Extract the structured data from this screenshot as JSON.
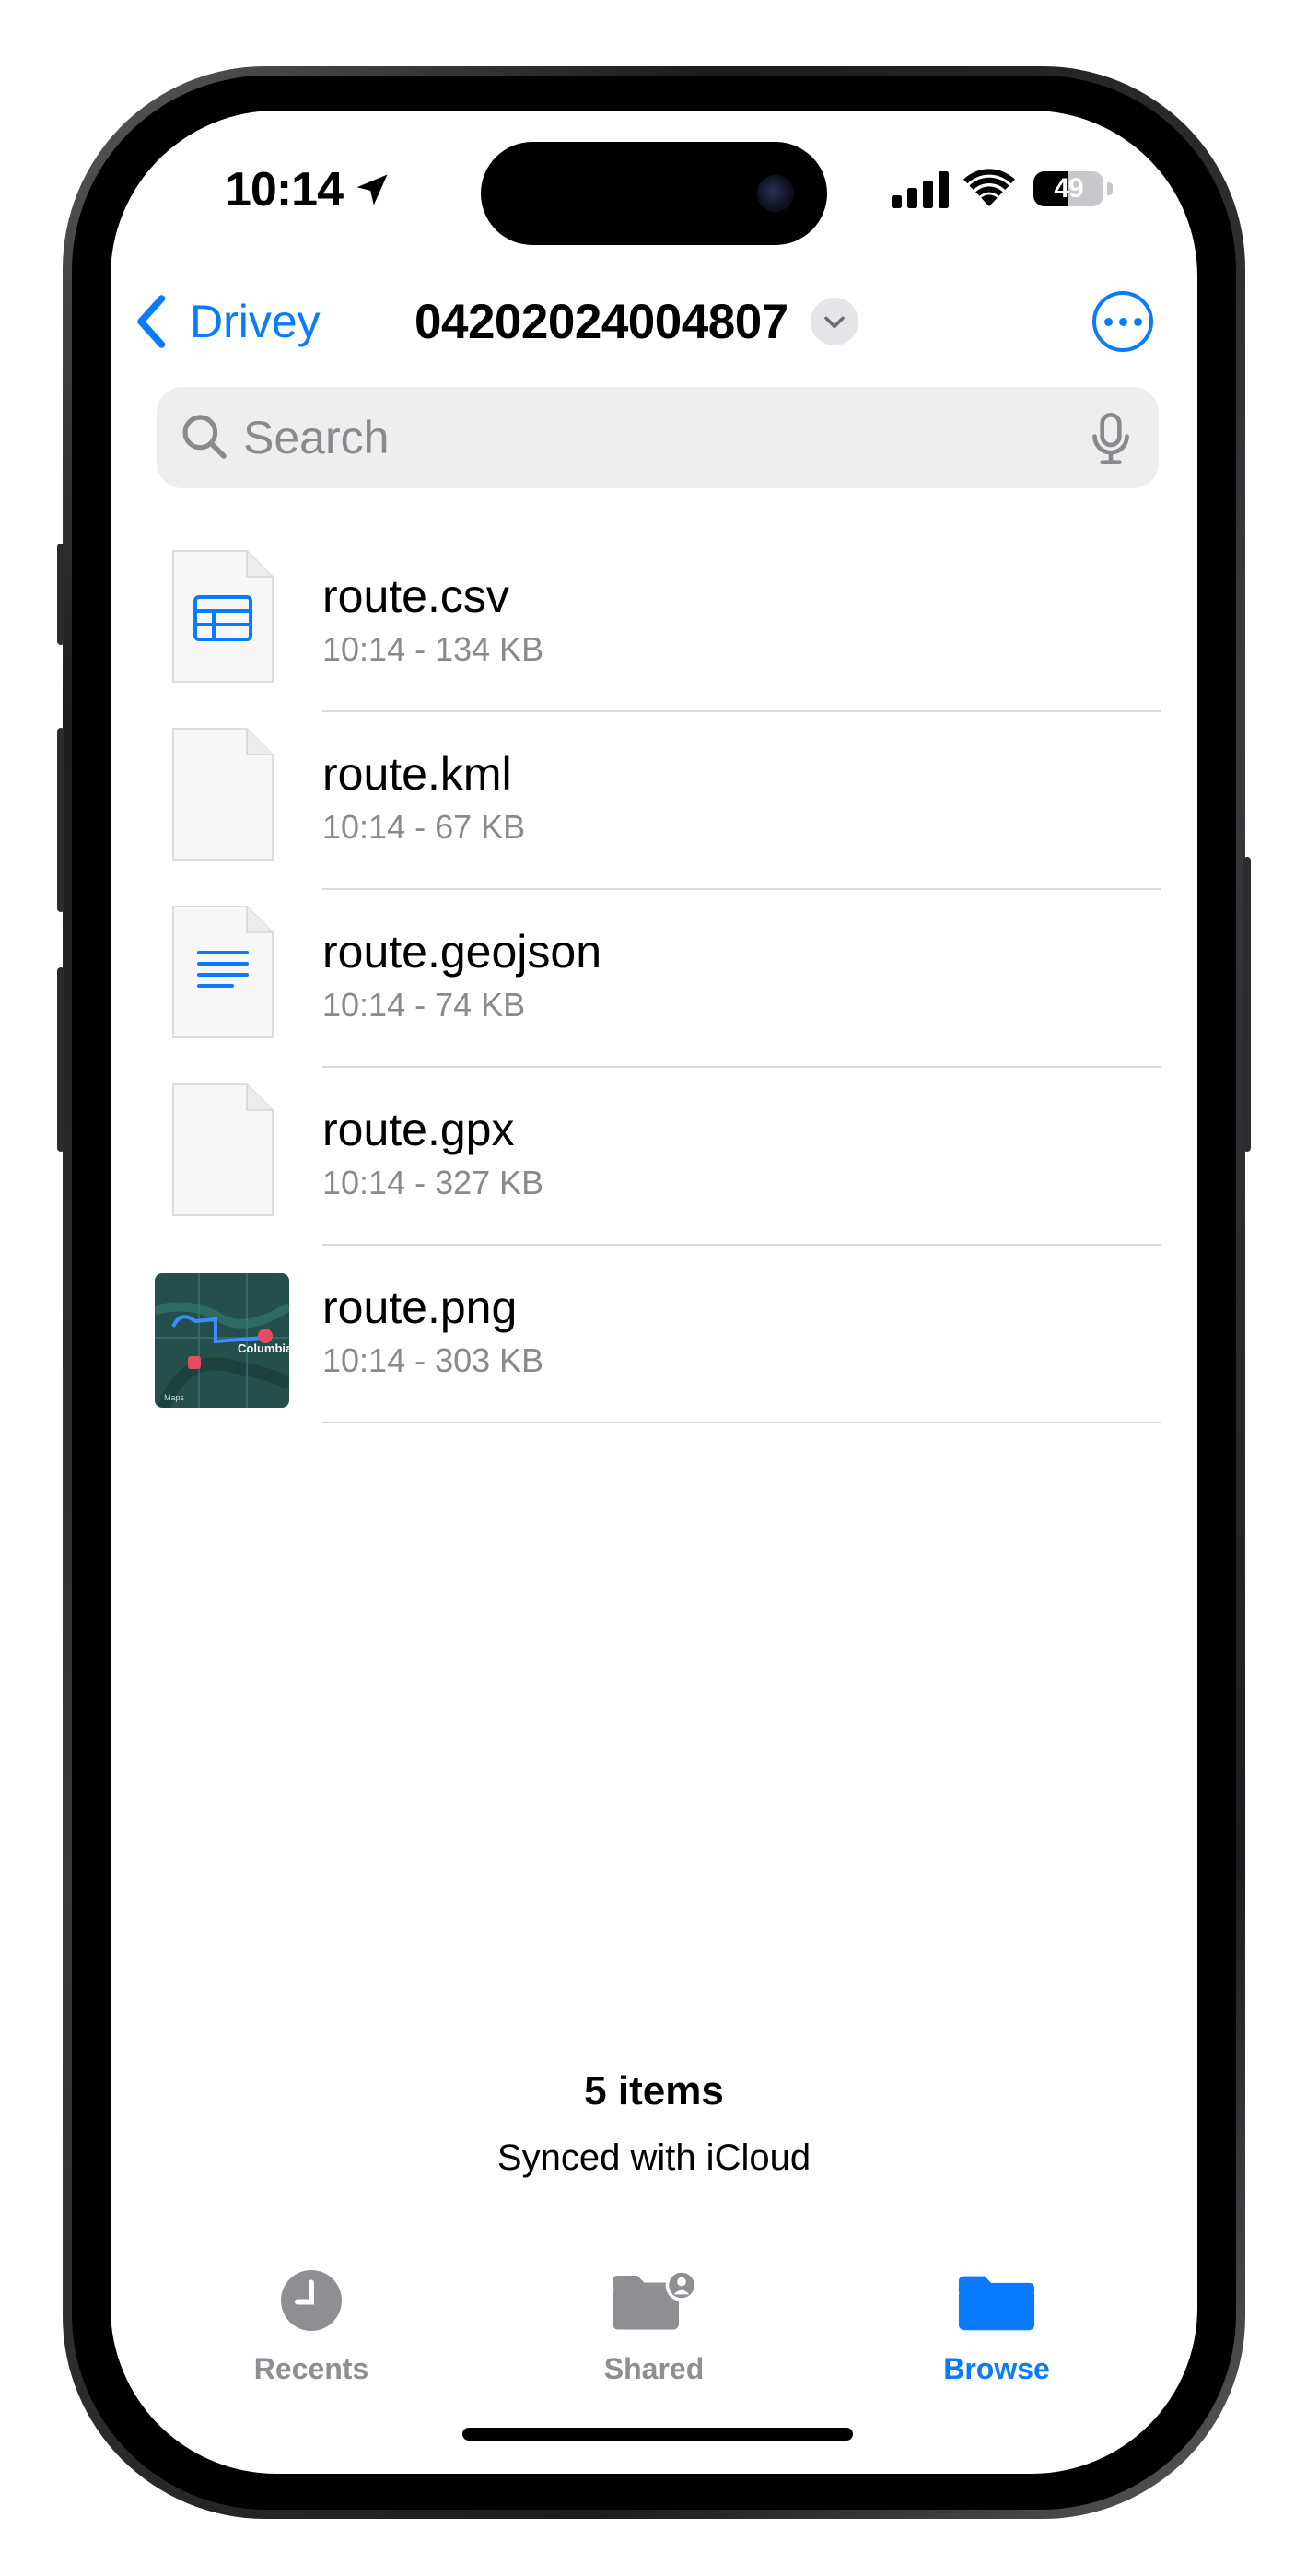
{
  "status_bar": {
    "time": "10:14",
    "battery_level": "49",
    "battery_fraction": 0.49,
    "icons": [
      "location-arrow-icon",
      "cellular-signal-icon",
      "wifi-icon",
      "battery-icon"
    ]
  },
  "nav": {
    "back_label": "Drivey",
    "title": "04202024004807",
    "icons": [
      "chevron-left-icon",
      "chevron-down-icon",
      "ellipsis-circle-icon"
    ]
  },
  "search": {
    "placeholder": "Search",
    "value": ""
  },
  "files": [
    {
      "name": "route.csv",
      "meta": "10:14 - 134 KB",
      "icon": "spreadsheet-document-icon"
    },
    {
      "name": "route.kml",
      "meta": "10:14 - 67 KB",
      "icon": "blank-document-icon"
    },
    {
      "name": "route.geojson",
      "meta": "10:14 - 74 KB",
      "icon": "text-document-icon"
    },
    {
      "name": "route.gpx",
      "meta": "10:14 - 327 KB",
      "icon": "blank-document-icon"
    },
    {
      "name": "route.png",
      "meta": "10:14 - 303 KB",
      "icon": "map-thumbnail-image"
    }
  ],
  "map_thumbnail": {
    "city_label": "Columbia",
    "watermark": "Maps"
  },
  "footer": {
    "count": "5 items",
    "sync_status": "Synced with iCloud"
  },
  "tabs": [
    {
      "label": "Recents",
      "icon": "clock-icon",
      "active": false
    },
    {
      "label": "Shared",
      "icon": "shared-folder-icon",
      "active": false
    },
    {
      "label": "Browse",
      "icon": "folder-icon",
      "active": true
    }
  ],
  "colors": {
    "accent": "#0a7aff",
    "inactive": "#8e8e93",
    "search_bg": "#eeeeef"
  }
}
